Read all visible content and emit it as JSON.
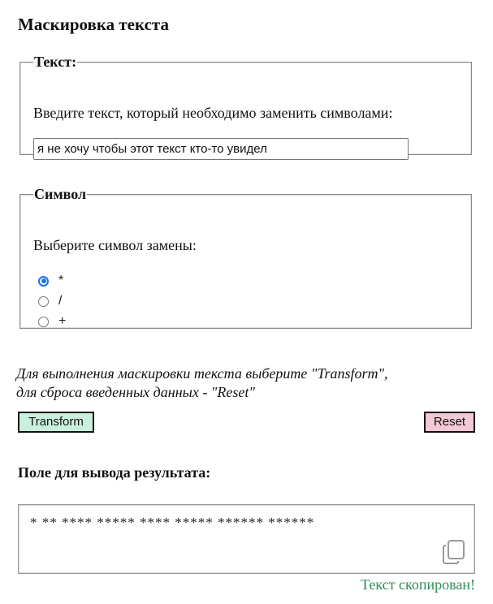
{
  "page": {
    "title": "Маскировка текста"
  },
  "text_section": {
    "legend": "Текст:",
    "prompt": "Введите текст, который необходимо заменить символами:",
    "input_value": "я не хочу чтобы этот текст кто-то увидел"
  },
  "symbol_section": {
    "legend": "Символ",
    "prompt": "Выберите символ замены:",
    "options": [
      {
        "label": "*",
        "checked": true
      },
      {
        "label": "/",
        "checked": false
      },
      {
        "label": "+",
        "checked": false
      }
    ]
  },
  "hint": {
    "line1": "Для выполнения маскировки текста выберите \"Transform\",",
    "line2": "для сброса введенных данных - \"Reset\""
  },
  "buttons": {
    "transform_label": "Transform",
    "reset_label": "Reset"
  },
  "result": {
    "title": "Поле для вывода результата:",
    "value": "* ** **** ***** **** ***** ****** ******",
    "copied_message": "Текст скопирован!"
  },
  "colors": {
    "transform_bg": "#c8f0dc",
    "reset_bg": "#f4c8d4",
    "radio_accent": "#1a73e8",
    "copied_text": "#2e8b57"
  },
  "icons": {
    "copy": "copy-icon"
  }
}
